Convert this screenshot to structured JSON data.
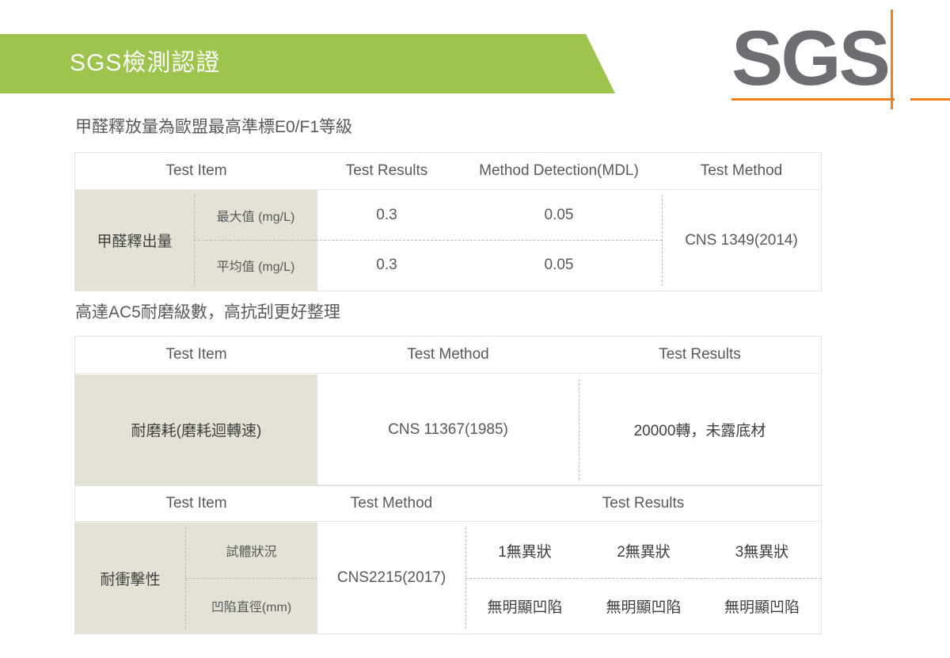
{
  "header": {
    "banner_title": "SGS檢測認證",
    "logo_text": "SGS",
    "banner_color": "#9dc44d",
    "logo_color": "#6d6e71",
    "accent_color": "#ef8022"
  },
  "sections": [
    {
      "caption": "甲醛釋放量為歐盟最高準標E0/F1等級",
      "table": {
        "headers": [
          "Test Item",
          "Test Results",
          "Method Detection(MDL)",
          "Test Method"
        ],
        "row_group_label": "甲醛釋出量",
        "subrows": [
          {
            "sub_label": "最大值 (mg/L)",
            "test_results": "0.3",
            "mdl": "0.05"
          },
          {
            "sub_label": "平均值 (mg/L)",
            "test_results": "0.3",
            "mdl": "0.05"
          }
        ],
        "test_method": "CNS 1349(2014)"
      }
    },
    {
      "caption": "高達AC5耐磨級數，高抗刮更好整理",
      "table": {
        "headers": [
          "Test Item",
          "Test Method",
          "Test Results"
        ],
        "test_item": "耐磨耗(磨耗迴轉速)",
        "test_method": "CNS 11367(1985)",
        "test_results": "20000轉，未露底材"
      }
    },
    {
      "caption": "",
      "table": {
        "headers": [
          "Test Item",
          "Test Method",
          "Test Results"
        ],
        "row_group_label": "耐衝擊性",
        "subrows": [
          {
            "sub_label": "試體狀況",
            "results": [
              "1無異狀",
              "2無異狀",
              "3無異狀"
            ]
          },
          {
            "sub_label": "凹陷直徑(mm)",
            "results": [
              "無明顯凹陷",
              "無明顯凹陷",
              "無明顯凹陷"
            ]
          }
        ],
        "test_method": "CNS2215(2017)"
      }
    }
  ],
  "colors": {
    "beige_cell": "#e4e2d4",
    "border": "#e2e2e2",
    "text": "#58595b"
  }
}
